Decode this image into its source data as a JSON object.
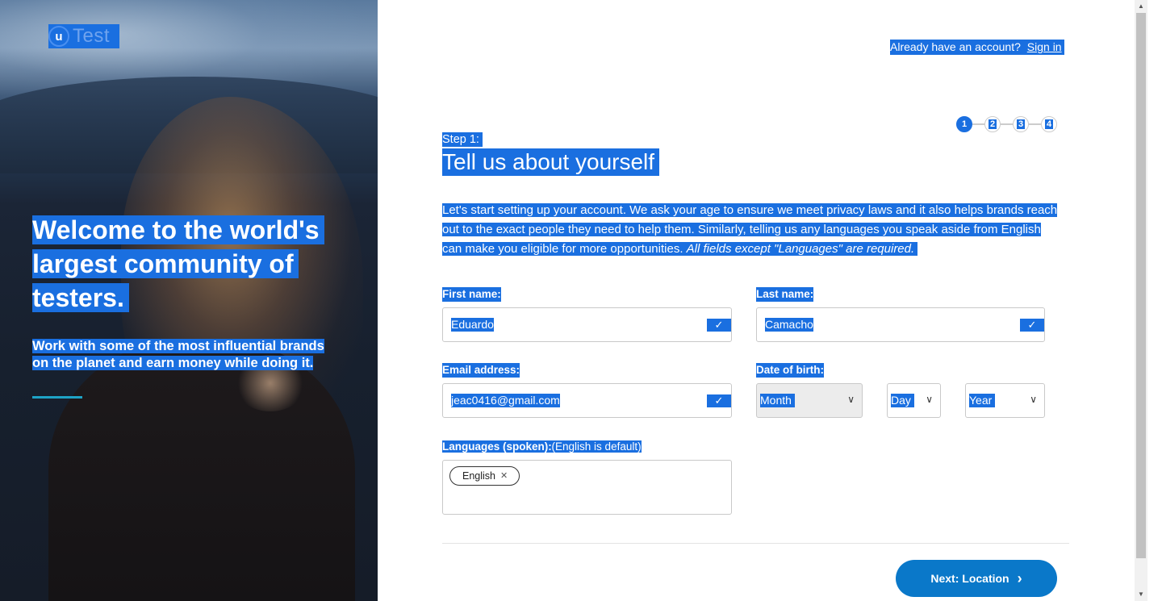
{
  "brand": {
    "logo_letter": "u",
    "logo_word": "Test"
  },
  "hero": {
    "title_lines": [
      "Welcome to the world's",
      "largest community of",
      "testers."
    ],
    "subtitle_lines": [
      "Work with some of the most influential brands",
      "on the planet and earn money while doing it."
    ]
  },
  "header": {
    "question": "Already have an account?",
    "signin_label": "Sign in"
  },
  "stepper": {
    "steps": [
      "1",
      "2",
      "3",
      "4"
    ],
    "active": "1"
  },
  "step": {
    "label": "Step 1:",
    "title": "Tell us about yourself"
  },
  "intro": {
    "text": "Let's start setting up your account. We ask your age to ensure we meet privacy laws and it also helps brands reach out to the exact people they need to help them. Similarly, telling us any languages you speak aside from English can make you eligible for more opportunities.",
    "emphasis": "All fields except \"Languages\" are required."
  },
  "form": {
    "first_name": {
      "label": "First name:",
      "value": "Eduardo"
    },
    "last_name": {
      "label": "Last name:",
      "value": "Camacho"
    },
    "email": {
      "label": "Email address:",
      "value": "jeac0416@gmail.com"
    },
    "dob": {
      "label": "Date of birth:",
      "month": "Month",
      "day": "Day",
      "year": "Year"
    },
    "languages": {
      "label": "Languages (spoken):",
      "hint": "(English is default)",
      "chips": [
        "English"
      ]
    }
  },
  "actions": {
    "next_label": "Next: Location"
  },
  "icons": {
    "check": "check-icon",
    "chevron_right": "chevron-right-icon",
    "chevron_down": "chevron-down-icon",
    "remove": "close-icon"
  },
  "colors": {
    "accent": "#1a6fe0",
    "button": "#0a78c9",
    "hero_bar": "#1ea3c6"
  }
}
